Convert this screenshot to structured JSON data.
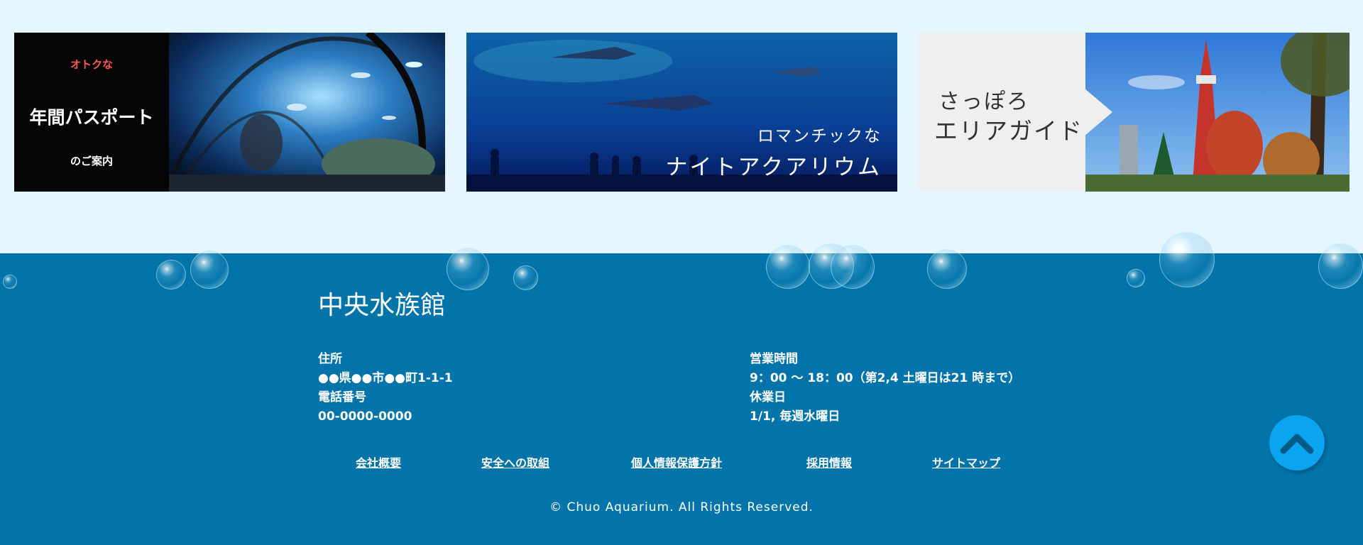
{
  "banners": {
    "passport": {
      "label_red": "オトクな",
      "label_big": "年間パスポート",
      "label_small": "のご案内"
    },
    "night": {
      "line1": "ロマンチックな",
      "line2": "ナイトアクアリウム"
    },
    "sapporo": {
      "line1": "さっぽろ",
      "line2": "エリアガイド"
    }
  },
  "footer": {
    "title": "中央水族館",
    "left": {
      "address_label": "住所",
      "address_value": "●●県●●市●●町1-1-1",
      "phone_label": "電話番号",
      "phone_value": "00-0000-0000"
    },
    "right": {
      "hours_label": "営業時間",
      "hours_value": "9：00 ～ 18：00（第2,4 土曜日は21 時まで）",
      "closed_label": "休業日",
      "closed_value": "1/1, 毎週水曜日"
    },
    "links": [
      "会社概要",
      "安全への取組",
      "個人情報保護方針",
      "採用情報",
      "サイトマップ"
    ],
    "copyright": "© Chuo Aquarium. All Rights Reserved."
  },
  "colors": {
    "page_bg": "#e5f6fe",
    "footer_bg": "#0274a9",
    "accent_red": "#ff5a57",
    "totop_bg": "#0aa5ee"
  },
  "icons": {
    "totop": "chevron-up-icon"
  }
}
